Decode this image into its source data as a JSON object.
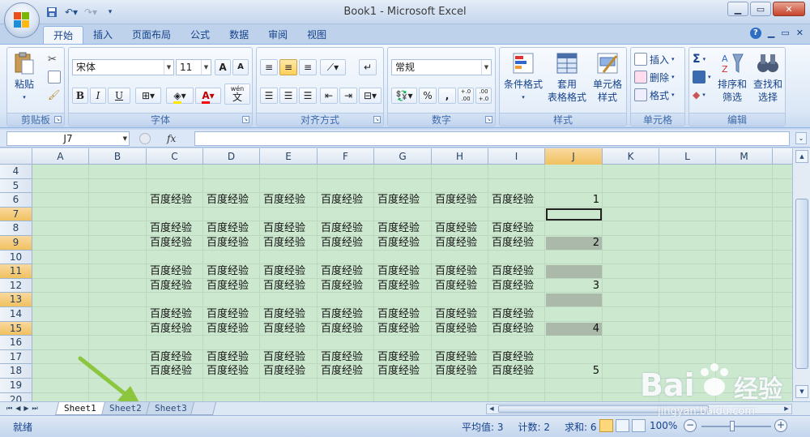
{
  "window": {
    "title": "Book1 - Microsoft Excel"
  },
  "tabs": [
    "开始",
    "插入",
    "页面布局",
    "公式",
    "数据",
    "审阅",
    "视图"
  ],
  "ribbon": {
    "clipboard": {
      "label": "剪贴板",
      "paste": "粘贴"
    },
    "font": {
      "label": "字体",
      "name": "宋体",
      "size": "11",
      "bold": "B",
      "italic": "I",
      "underline": "U",
      "wen": "wén",
      "wen_char": "文",
      "grow": "A",
      "shrink": "A"
    },
    "alignment": {
      "label": "对齐方式"
    },
    "number": {
      "label": "数字",
      "format": "常规",
      "percent": "%",
      "comma": ",",
      "inc_dec": "+.0 .00",
      "dec_dec": ".00 +.0"
    },
    "styles": {
      "label": "样式",
      "conditional": "条件格式",
      "table_1": "套用",
      "table_2": "表格格式",
      "cell_styles_1": "单元格",
      "cell_styles_2": "样式"
    },
    "cells": {
      "label": "单元格",
      "insert": "插入",
      "delete": "删除",
      "format": "格式"
    },
    "editing": {
      "label": "编辑",
      "sort_1": "排序和",
      "sort_2": "筛选",
      "find_1": "查找和",
      "find_2": "选择",
      "sigma": "Σ"
    }
  },
  "formula_bar": {
    "name_box": "J7",
    "fx": "fx",
    "value": ""
  },
  "columns": [
    "A",
    "B",
    "C",
    "D",
    "E",
    "F",
    "G",
    "H",
    "I",
    "J",
    "K",
    "L",
    "M"
  ],
  "selected_column": "J",
  "rows": [
    "4",
    "5",
    "6",
    "7",
    "8",
    "9",
    "10",
    "11",
    "12",
    "13",
    "14",
    "15",
    "16",
    "17",
    "18",
    "19",
    "20"
  ],
  "selected_rows": [
    "7",
    "9",
    "11",
    "13",
    "15"
  ],
  "cell_text": "百度经验",
  "text_rows": [
    "6",
    "8",
    "9",
    "11",
    "12",
    "14",
    "15",
    "17",
    "18"
  ],
  "j_values": {
    "6": "1",
    "9": "2",
    "12": "3",
    "15": "4",
    "18": "5"
  },
  "sheets": [
    "Sheet1",
    "Sheet2",
    "Sheet3"
  ],
  "active_sheet": "Sheet1",
  "status": {
    "mode": "就绪",
    "average": "平均值: 3",
    "count": "计数: 2",
    "sum": "求和: 6",
    "zoom": "100%"
  },
  "watermark": {
    "brand": "Bai",
    "brand_cn": "经验",
    "url": "jingyan.baidu.com"
  },
  "colors": {
    "grid_bg": "#cce8cf",
    "selection": "#aab9aa",
    "arrow": "#8cc63f",
    "header_sel": "#f1c15f"
  }
}
